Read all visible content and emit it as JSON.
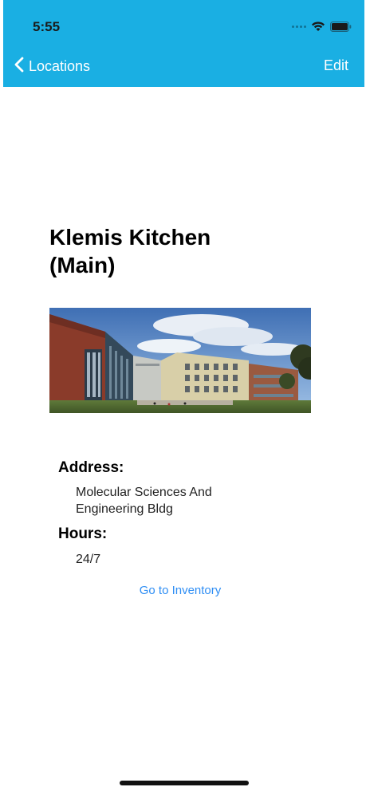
{
  "status_bar": {
    "time": "5:55"
  },
  "nav": {
    "back_label": "Locations",
    "edit_label": "Edit"
  },
  "location": {
    "title_line1": "Klemis Kitchen",
    "title_line2": "(Main)",
    "address_label": "Address:",
    "address_line1": "Molecular Sciences And",
    "address_line2": "Engineering Bldg",
    "hours_label": "Hours:",
    "hours_value": "24/7"
  },
  "actions": {
    "inventory_link": "Go to Inventory"
  },
  "colors": {
    "nav_background": "#1aafe3",
    "link": "#2f8ef4"
  },
  "icons": {
    "back": "chevron-left-icon",
    "wifi": "wifi-icon",
    "battery": "battery-icon",
    "signal": "cellular-signal-icon"
  }
}
